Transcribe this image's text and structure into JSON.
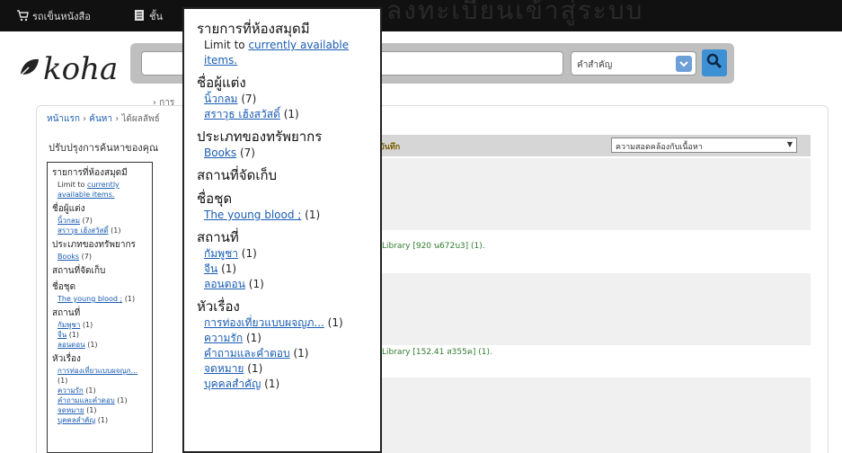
{
  "topbar": {
    "cart_label": "รถเข็นหนังสือ",
    "lists_label": "ชั้น",
    "ghost_text": "ลงทะเบียนเข้าสู่ระบบ"
  },
  "header": {
    "logo_text": "koha",
    "search_placeholder": "",
    "search_type": "คำสำคัญ",
    "subnav": "› การ"
  },
  "breadcrumb": {
    "home": "หน้าแรก",
    "sep1": " › ",
    "search": "ค้นหา",
    "sep2": " › ",
    "results": "ได้ผลลัพธ์"
  },
  "refine_title": "ปรับปรุงการค้นหาของคุณ",
  "results": {
    "save_label": "บันทึก",
    "sort_value": "ความสอดคล้องกับเนื้อหา",
    "rows": [
      {
        "availability": "Library [920 น672บ3] (1)."
      },
      {
        "availability": "Library [152.41 ส355ค] (1)."
      }
    ]
  },
  "facets": {
    "availability_heading": "รายการที่ห้องสมุดมี",
    "limit_prefix": "Limit to ",
    "limit_link": "currently available items.",
    "authors_heading": "ชื่อผู้แต่ง",
    "authors": [
      {
        "name": "นิ้วกลม",
        "count": "(7)"
      },
      {
        "name": "สราวุธ เฮ้งสวัสดิ์",
        "count": "(1)"
      }
    ],
    "itemtype_heading": "ประเภทของทรัพยากร",
    "itemtypes": [
      {
        "name": "Books",
        "count": "(7)"
      }
    ],
    "location_heading": "สถานที่จัดเก็บ",
    "series_heading": "ชื่อชุด",
    "series": [
      {
        "name": "The young blood ;",
        "count": "(1)"
      }
    ],
    "place_heading": "สถานที่",
    "places": [
      {
        "name": "กัมพูชา",
        "count": "(1)"
      },
      {
        "name": "จีน",
        "count": "(1)"
      },
      {
        "name": "ลอนดอน",
        "count": "(1)"
      }
    ],
    "topic_heading": "หัวเรื่อง",
    "topics": [
      {
        "name": "การท่องเที่ยวแบบผจญภ...",
        "count": "(1)"
      },
      {
        "name": "ความรัก",
        "count": "(1)"
      },
      {
        "name": "คำถามและคำตอบ",
        "count": "(1)"
      },
      {
        "name": "จดหมาย",
        "count": "(1)"
      },
      {
        "name": "บุคคลสำคัญ",
        "count": "(1)"
      }
    ]
  }
}
